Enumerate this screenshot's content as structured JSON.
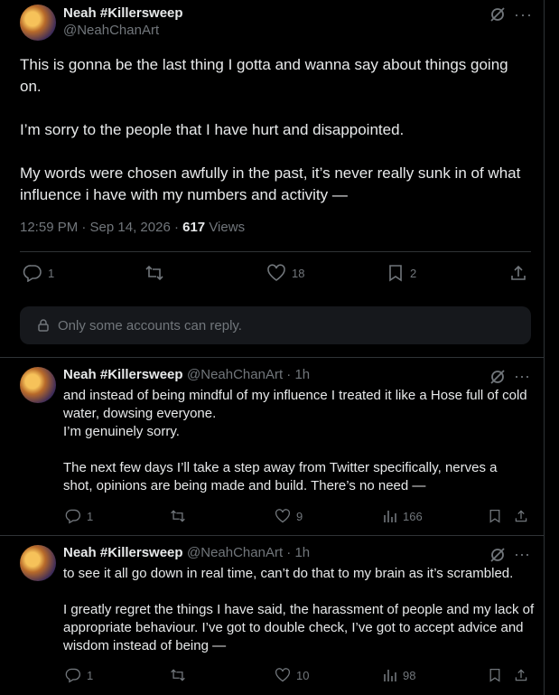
{
  "main_tweet": {
    "author_name": "Neah #Killersweep",
    "author_handle": "@NeahChanArt",
    "text": "This is gonna be the last thing I gotta and wanna say about things going on.\n\nI’m sorry to the people that I have hurt and disappointed.\n\nMy words were chosen awfully in the past, it’s never really sunk in of what influence i have with my numbers and activity —",
    "time": "12:59 PM · Sep 14, 2026 · ",
    "views_count": "617",
    "views_label": " Views",
    "replies": "1",
    "retweets": "",
    "likes": "18",
    "bookmarks": "2",
    "restriction": "Only some accounts can reply."
  },
  "replies": [
    {
      "author_name": "Neah #Killersweep",
      "author_handle": "@NeahChanArt · 1h",
      "text": "and instead of being mindful of my influence I treated it like a Hose full of cold water, dowsing everyone.\nI’m genuinely sorry.\n\nThe next few days I’ll take a step away from Twitter specifically, nerves a shot, opinions are being made and build. There’s no need —",
      "replies": "1",
      "likes": "9",
      "views": "166"
    },
    {
      "author_name": "Neah #Killersweep",
      "author_handle": "@NeahChanArt · 1h",
      "text": "to see it all go down in real time, can’t do that to my brain as it’s scrambled.\n\nI greatly regret the things I have said, the harassment of people and my lack of appropriate behaviour. I’ve got to double check, I’ve got to accept advice and wisdom instead of being —",
      "replies": "1",
      "likes": "10",
      "views": "98"
    }
  ]
}
